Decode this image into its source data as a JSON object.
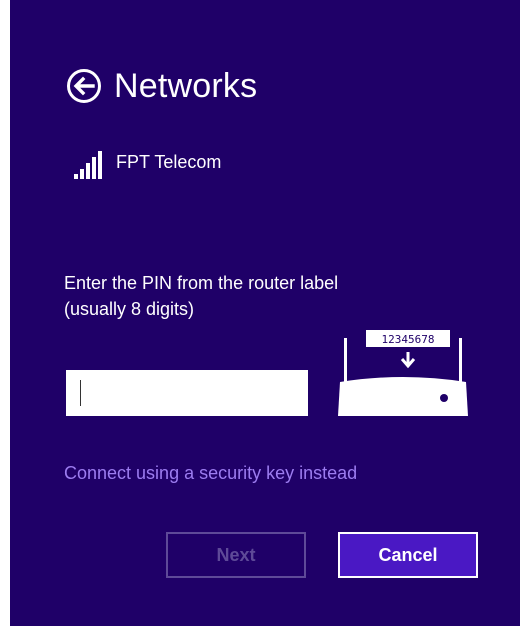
{
  "header": {
    "title": "Networks",
    "back_icon": "back-arrow-circle-icon"
  },
  "network": {
    "name": "FPT Telecom",
    "signal_icon": "wifi-signal-bars-icon"
  },
  "pin_entry": {
    "prompt": "Enter the PIN from the router label (usually 8 digits)",
    "value": "",
    "placeholder": ""
  },
  "router_illustration": {
    "sample_pin": "12345678",
    "icon": "router-icon"
  },
  "alt_link": {
    "label": "Connect using a security key instead"
  },
  "buttons": {
    "next": {
      "label": "Next",
      "enabled": false
    },
    "cancel": {
      "label": "Cancel",
      "enabled": true
    }
  },
  "colors": {
    "background": "#1f0068",
    "link": "#9c7cf0",
    "cancel_fill": "#4a18c4",
    "disabled": "#5e4a98"
  }
}
